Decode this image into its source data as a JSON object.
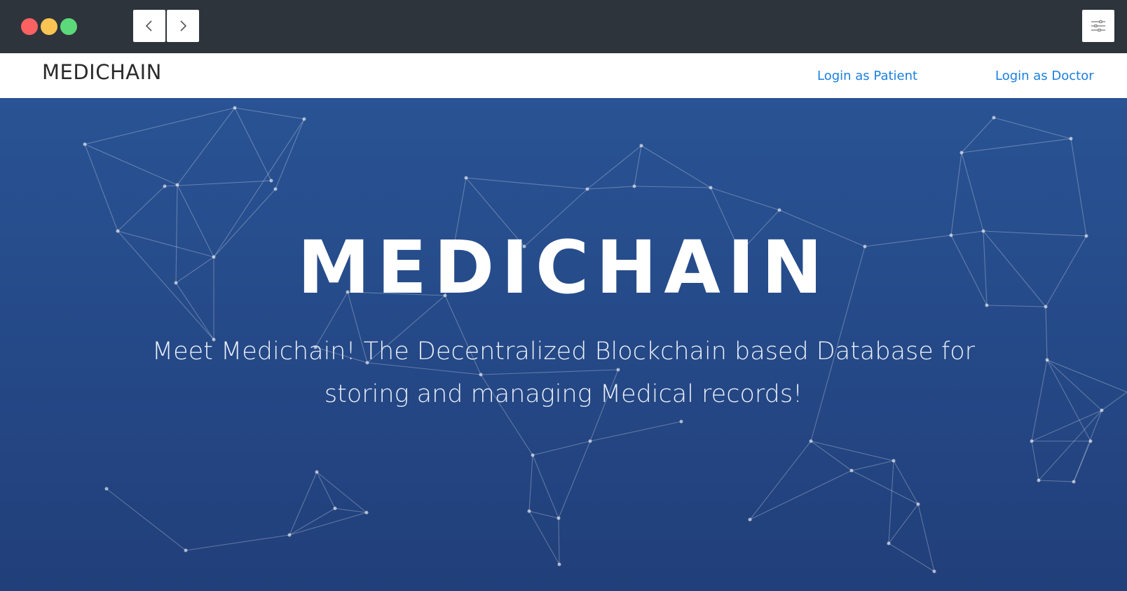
{
  "window": {
    "controls": [
      "close",
      "minimize",
      "maximize"
    ],
    "nav_back_icon": "chevron-left-icon",
    "nav_forward_icon": "chevron-right-icon",
    "menu_icon": "sliders-icon"
  },
  "navbar": {
    "brand": "MEDICHAIN",
    "links": [
      {
        "label": "Login as Patient"
      },
      {
        "label": "Login as Doctor"
      }
    ]
  },
  "hero": {
    "title": "MEDICHAIN",
    "subtitle": "Meet Medichain! The Decentralized Blockchain based Database for storing and managing Medical records!"
  },
  "colors": {
    "titlebar": "#2d343b",
    "hero_top": "#295394",
    "hero_bottom": "#213f7a",
    "link": "#1a7fe0",
    "close": "#fc6161",
    "minimize": "#f9c453",
    "maximize": "#5cd97b"
  }
}
